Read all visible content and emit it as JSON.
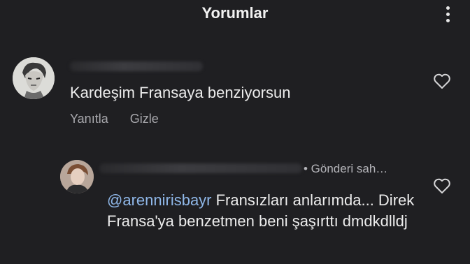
{
  "header": {
    "title": "Yorumlar",
    "more_icon": "more-vertical-icon"
  },
  "comments": [
    {
      "avatar": "avatar-anime-character",
      "username": "",
      "text": "Kardeşim Fransaya benziyorsun",
      "actions": {
        "reply": "Yanıtla",
        "hide": "Gizle"
      },
      "like_icon": "heart-outline-icon"
    },
    {
      "avatar": "avatar-user-photo",
      "username": "",
      "badge": "• Gönderi sah…",
      "mention": "@arennirisbayr",
      "text": " Fransızları anlarımda... Direk Fransa'ya benzetmen beni şaşırttı dmdkdlldj",
      "like_icon": "heart-outline-icon"
    }
  ],
  "colors": {
    "background": "#1f1f22",
    "text": "#ececec",
    "secondary": "#a8a8ad",
    "mention": "#8fb7e8"
  }
}
